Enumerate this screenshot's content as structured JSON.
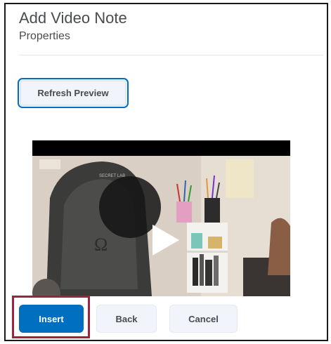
{
  "dialog": {
    "title": "Add Video Note",
    "subtitle": "Properties"
  },
  "toolbar": {
    "refresh_label": "Refresh Preview"
  },
  "video": {
    "play_icon": "play-icon",
    "chair_logo_text": "SECRET LAB",
    "chair_symbol": "Ω"
  },
  "footer": {
    "insert_label": "Insert",
    "back_label": "Back",
    "cancel_label": "Cancel"
  },
  "colors": {
    "primary": "#006fbf",
    "highlight_outline": "#a3203b",
    "text": "#494c4e"
  }
}
